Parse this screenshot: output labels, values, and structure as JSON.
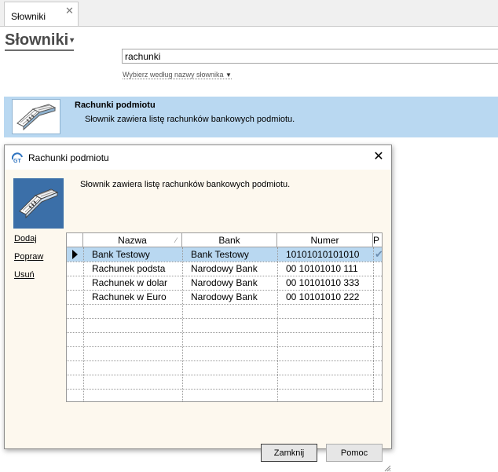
{
  "tab": {
    "label": "Słowniki",
    "close": "✕"
  },
  "page": {
    "title": "Słowniki",
    "title_caret": "▾"
  },
  "search": {
    "value": "rachunki",
    "mode_label": "Wybierz według nazwy słownika",
    "mode_caret": "▼"
  },
  "result": {
    "title": "Rachunki podmiotu",
    "description": "Słownik zawiera listę rachunków bankowych podmiotu."
  },
  "dialog": {
    "title": "Rachunki podmiotu",
    "close": "✕",
    "description": "Słownik zawiera listę rachunków bankowych podmiotu.",
    "actions": [
      "Dodaj",
      "Popraw",
      "Usuń"
    ],
    "columns": [
      "Nazwa",
      "Bank",
      "Numer",
      "P"
    ],
    "rows": [
      {
        "nazwa": "Bank Testowy",
        "bank": "Bank Testowy",
        "numer": "10101010101010",
        "p": "✔",
        "selected": true
      },
      {
        "nazwa": "Rachunek podsta",
        "bank": "Narodowy Bank",
        "numer": "00 10101010 111",
        "p": "",
        "selected": false
      },
      {
        "nazwa": "Rachunek w dolar",
        "bank": "Narodowy Bank",
        "numer": "00 10101010 333",
        "p": "",
        "selected": false
      },
      {
        "nazwa": "Rachunek w Euro",
        "bank": "Narodowy Bank",
        "numer": "00 10101010 222",
        "p": "",
        "selected": false
      }
    ],
    "buttons": {
      "close": "Zamknij",
      "help": "Pomoc"
    }
  },
  "icons": {
    "tab_close": "close-icon",
    "dialog_close": "close-icon",
    "result": "ledger-book-icon",
    "dialog_logo": "app-logo-icon",
    "row_pointer": "row-pointer-icon"
  },
  "colors": {
    "selection": "#b9d8f1",
    "dialog_body": "#fdf8ee",
    "title_text": "#4a4a4a"
  }
}
